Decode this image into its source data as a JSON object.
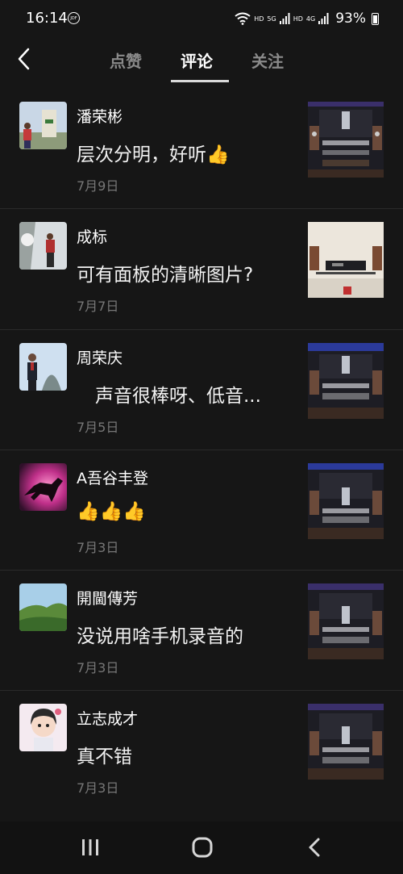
{
  "status": {
    "time": "16:14",
    "time_badge": "JDF",
    "hd1": "HD",
    "sig1": "5G",
    "hd2": "HD",
    "sig2": "4G",
    "battery": "93%"
  },
  "tabs": [
    {
      "label": "点赞",
      "active": false
    },
    {
      "label": "评论",
      "active": true
    },
    {
      "label": "关注",
      "active": false
    }
  ],
  "comments": [
    {
      "user": "潘荣彬",
      "text": "层次分明，好听👍",
      "date": "7月9日"
    },
    {
      "user": "成标",
      "text": "可有面板的清晰图片?",
      "date": "7月7日"
    },
    {
      "user": "周荣庆",
      "text": "　声音很棒呀、低音...",
      "date": "7月5日"
    },
    {
      "user": "A吾谷丰登",
      "text": "👍👍👍",
      "date": "7月3日"
    },
    {
      "user": "開閫傳芳",
      "text": "没说用啥手机录音的",
      "date": "7月3日"
    },
    {
      "user": "立志成才",
      "text": "真不错",
      "date": "7月3日"
    }
  ],
  "icons": {
    "back": "back-arrow-icon",
    "nav_recent": "recent-apps-icon",
    "nav_home": "home-icon",
    "nav_back": "nav-back-icon"
  },
  "colors": {
    "background": "#161616",
    "tab_inactive": "#8a8a8a",
    "date": "#777777",
    "underline": "#d9d9d9"
  }
}
